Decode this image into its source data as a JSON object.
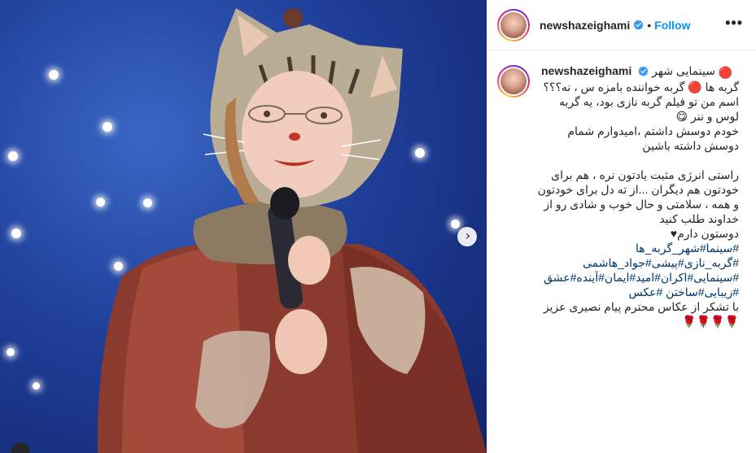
{
  "post": {
    "username": "newshazeighami",
    "follow_label": "Follow",
    "more_label": "•••",
    "separator": "•",
    "caption_first_line": "سینمایی شهر",
    "caption_lines": [
      "گربه ها 🔴 گربه خواننده بامزه س ، نه؟؟؟",
      "اسم من تو فیلم گربه نازی بود، یه گربه",
      "لوس و ننر 😋",
      "خودم دوسش داشتم ،امیدوارم شمام",
      "دوسش داشته باشین",
      "",
      "راستی انرژی مثبت یادتون نره ، هم برای",
      "خودتون هم دیگران ...از ته دل برای خودتون",
      "و همه ، سلامتی و حال خوب و شادی رو از",
      "خداوند طلب کنید",
      "دوستون دارم♥"
    ],
    "hashtag_lines": [
      "#سینما#شهر_گربه_ها",
      "#گربه_نازی#پیشی#جواد_هاشمی",
      "#سینمایی#اکران#امید#ایمان#آینده#عشق",
      "#زیبایی#ساختن #عکس"
    ],
    "credit_line": "با تشکر از عکاس محترم پیام نصیری عزیز",
    "roses": "🌹🌹🌹🌹"
  },
  "media": {
    "next_arrow": "›"
  },
  "colors": {
    "link": "#0095f6",
    "hashtag": "#00376b",
    "verified": "#3897f0",
    "background_stage": "#1f3f9a"
  },
  "icons": [
    "verified-badge-icon",
    "chevron-right-icon",
    "more-options-icon",
    "user-tag-icon"
  ]
}
